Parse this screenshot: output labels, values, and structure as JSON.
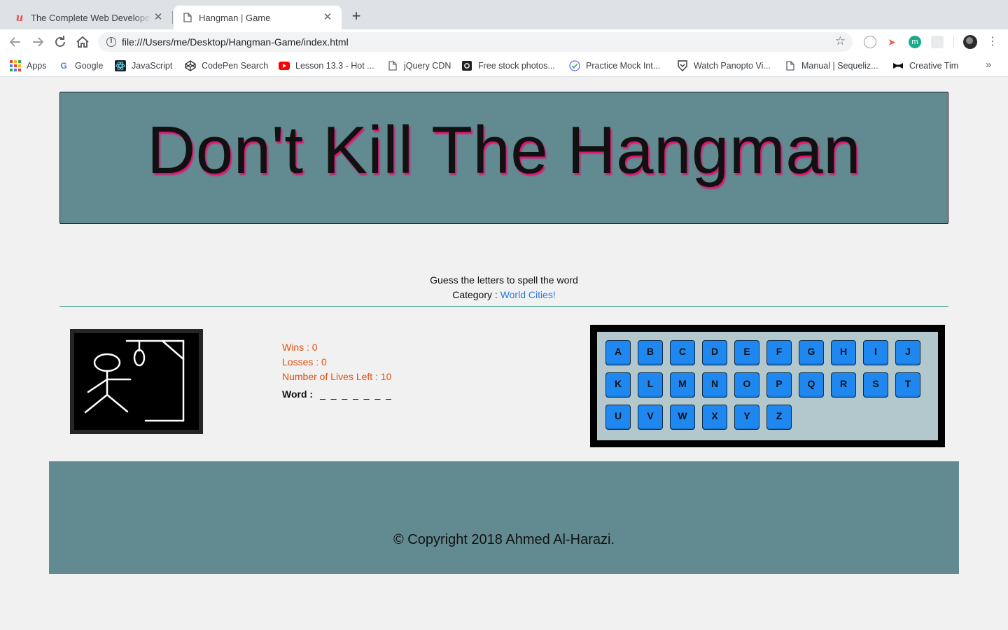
{
  "browser": {
    "tabs": [
      {
        "title": "The Complete Web Developer Bootcamp",
        "favicon": "udemy-icon",
        "active": false
      },
      {
        "title": "Hangman | Game",
        "favicon": "document-icon",
        "active": true
      }
    ],
    "address_url": "file:///Users/me/Desktop/Hangman-Game/index.html",
    "bookmarks": [
      {
        "label": "Apps",
        "icon": "apps-grid-icon"
      },
      {
        "label": "Google",
        "icon": "google-icon"
      },
      {
        "label": "JavaScript",
        "icon": "react-icon"
      },
      {
        "label": "CodePen Search",
        "icon": "codepen-icon"
      },
      {
        "label": "Lesson 13.3 - Hot ...",
        "icon": "youtube-icon"
      },
      {
        "label": "jQuery CDN",
        "icon": "document-icon"
      },
      {
        "label": "Free stock photos...",
        "icon": "camera-icon"
      },
      {
        "label": "Practice Mock Int...",
        "icon": "check-icon"
      },
      {
        "label": "Watch Panopto Vi...",
        "icon": "shield-icon"
      },
      {
        "label": "Manual | Sequeliz...",
        "icon": "document-icon"
      },
      {
        "label": "Creative Tim",
        "icon": "bowtie-icon"
      }
    ]
  },
  "game": {
    "title": "Don't Kill The Hangman",
    "instruction": "Guess the letters to spell the word",
    "category_label": "Category : ",
    "category_value": "World Cities!",
    "wins": "Wins : 0",
    "losses": "Losses : 0",
    "lives": "Number of Lives Left : 10",
    "word_label": "Word :",
    "word_blanks": "_ _ _ _ _ _ _",
    "letters": [
      "A",
      "B",
      "C",
      "D",
      "E",
      "F",
      "G",
      "H",
      "I",
      "J",
      "K",
      "L",
      "M",
      "N",
      "O",
      "P",
      "Q",
      "R",
      "S",
      "T",
      "U",
      "V",
      "W",
      "X",
      "Y",
      "Z"
    ]
  },
  "footer": {
    "copyright": "© Copyright 2018 Ahmed Al-Harazi."
  },
  "colors": {
    "header_bg": "#628b91",
    "title_shadow": "#e01070",
    "stat_text": "#e04e0e",
    "category_link": "#2a7ae2",
    "key_bg": "#1e88f0",
    "keyboard_bg": "#b2c8cc"
  }
}
